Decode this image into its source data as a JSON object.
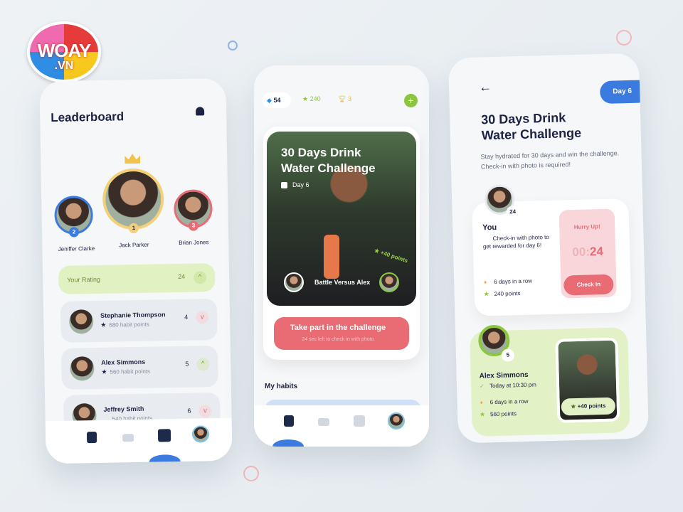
{
  "logo": {
    "text": "WOAY",
    "sub": ".VN"
  },
  "leaderboard": {
    "title": "Leaderboard",
    "podium": [
      {
        "name": "Jeniffer Clarke",
        "rank": "2"
      },
      {
        "name": "Jack Parker",
        "rank": "1"
      },
      {
        "name": "Brian Jones",
        "rank": "3"
      }
    ],
    "your_rating": {
      "label": "Your Rating",
      "value": "24"
    },
    "rows": [
      {
        "name": "Stephanie Thompson",
        "points": "680 habit points",
        "rank": "4",
        "trend": "down"
      },
      {
        "name": "Alex Simmons",
        "points": "560 habit points",
        "rank": "5",
        "trend": "up"
      },
      {
        "name": "Jeffrey Smith",
        "points": "540 habit points",
        "rank": "6",
        "trend": "down"
      }
    ]
  },
  "home": {
    "stats": {
      "gems": "54",
      "stars": "240",
      "trophies": "3"
    },
    "card": {
      "title_line1": "30 Days Drink",
      "title_line2": "Water Challenge",
      "day": "Day 6",
      "reward": "+40 points",
      "battle": "Battle Versus Alex"
    },
    "cta": {
      "label": "Take part in the challenge",
      "sub": "24 sec left to check in with photo"
    },
    "section": "My habits"
  },
  "detail": {
    "day_pill": "Day 6",
    "title_line1": "30 Days Drink",
    "title_line2": "Water Challenge",
    "desc": "Stay hydrated for 30 days and win the challenge. Check-in with photo is required!",
    "you": {
      "badge": "24",
      "name": "You",
      "text": "Check-in with photo to get rewarded for day 6!",
      "streak": "6 days in a row",
      "points": "240 points"
    },
    "hurry": {
      "label": "Hurry Up!",
      "mm": "00",
      "ss": "24",
      "button": "Check In"
    },
    "alex": {
      "badge": "5",
      "name": "Alex Simmons",
      "time": "Today at 10:30 pm",
      "streak": "6 days in a row",
      "points": "560 points",
      "reward": "+40 points"
    }
  },
  "colors": {
    "green": "#8cc63f",
    "red": "#e96b74",
    "blue": "#3b7be0",
    "lightgreen": "#e3f1c6"
  }
}
